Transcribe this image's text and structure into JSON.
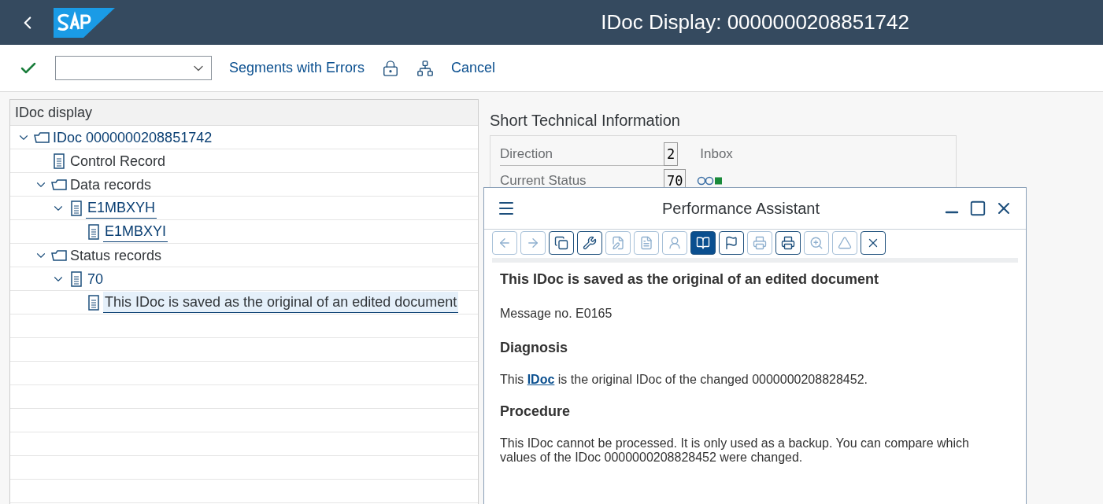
{
  "header": {
    "title": "IDoc Display: 0000000208851742"
  },
  "toolbar": {
    "buttons": [
      "Segments with Errors",
      "Cancel"
    ]
  },
  "tree": {
    "title": "IDoc display",
    "items": [
      {
        "label": "IDoc 0000000208851742",
        "kind": "folder",
        "link": false,
        "emphasis": true,
        "selected": false,
        "expanded": true,
        "children": [
          {
            "label": "Control Record",
            "kind": "doc",
            "link": false,
            "emphasis": false,
            "selected": false
          },
          {
            "label": "Data records",
            "kind": "folder",
            "link": false,
            "emphasis": false,
            "selected": false,
            "expanded": true,
            "children": [
              {
                "label": "E1MBXYH",
                "kind": "doc",
                "link": true,
                "emphasis": true,
                "selected": false,
                "expanded": true,
                "children": [
                  {
                    "label": "E1MBXYI",
                    "kind": "doc",
                    "link": true,
                    "emphasis": true,
                    "selected": false
                  }
                ]
              }
            ]
          },
          {
            "label": "Status records",
            "kind": "folder",
            "link": false,
            "emphasis": false,
            "selected": false,
            "expanded": true,
            "children": [
              {
                "label": "70",
                "kind": "doc",
                "link": false,
                "emphasis": true,
                "selected": false,
                "expanded": true,
                "children": [
                  {
                    "label": "This IDoc is saved as the original of an edited document",
                    "kind": "doc",
                    "link": false,
                    "emphasis": false,
                    "selected": true
                  }
                ]
              }
            ]
          }
        ]
      }
    ]
  },
  "info": {
    "title": "Short Technical Information",
    "fields": [
      {
        "kind": "text",
        "label": "Direction",
        "value": "2",
        "description": "Inbox"
      },
      {
        "kind": "status",
        "label": "Current Status",
        "value": "70"
      }
    ]
  },
  "assistant": {
    "title": "Performance Assistant",
    "tools": [
      {
        "selected": false,
        "disabled": true
      },
      {
        "selected": false,
        "disabled": true
      },
      {
        "selected": false,
        "disabled": false
      },
      {
        "selected": false,
        "disabled": false
      },
      {
        "selected": false,
        "disabled": true
      },
      {
        "selected": false,
        "disabled": true
      },
      {
        "selected": false,
        "disabled": true
      },
      {
        "selected": true,
        "disabled": false
      },
      {
        "selected": false,
        "disabled": false
      },
      {
        "selected": false,
        "disabled": true
      },
      {
        "selected": false,
        "disabled": false
      },
      {
        "selected": false,
        "disabled": true
      },
      {
        "selected": false,
        "disabled": true
      },
      {
        "selected": false,
        "disabled": false
      }
    ],
    "heading": "This IDoc is saved as the original of an edited document",
    "message_no": "Message no. E0165",
    "sections": [
      {
        "title": "Diagnosis",
        "before": "This ",
        "link": "IDoc",
        "after": " is the original IDoc of the changed 0000000208828452."
      },
      {
        "title": "Procedure",
        "before": "This IDoc cannot be processed. It is only used as a backup. You can compare which values of the IDoc 0000000208828452 were changed."
      }
    ]
  }
}
